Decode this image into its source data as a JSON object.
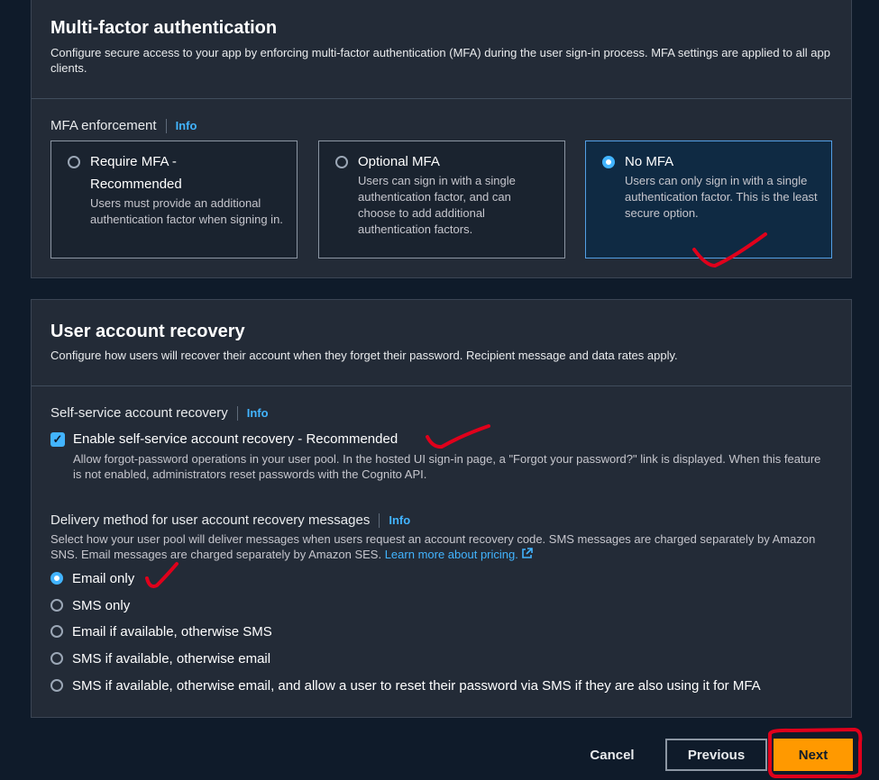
{
  "mfa": {
    "title": "Multi-factor authentication",
    "description": "Configure secure access to your app by enforcing multi-factor authentication (MFA) during the user sign-in process. MFA settings are applied to all app clients.",
    "enforcement_label": "MFA enforcement",
    "info": "Info",
    "options": [
      {
        "title": "Require MFA - Recommended",
        "desc": "Users must provide an additional authentication factor when signing in.",
        "selected": false
      },
      {
        "title": "Optional MFA",
        "desc": "Users can sign in with a single authentication factor, and can choose to add additional authentication factors.",
        "selected": false
      },
      {
        "title": "No MFA",
        "desc": "Users can only sign in with a single authentication factor. This is the least secure option.",
        "selected": true
      }
    ]
  },
  "recovery": {
    "title": "User account recovery",
    "description": "Configure how users will recover their account when they forget their password. Recipient message and data rates apply.",
    "self_service_label": "Self-service account recovery",
    "info": "Info",
    "enable_label": "Enable self-service account recovery - Recommended",
    "enable_checked": true,
    "enable_desc": "Allow forgot-password operations in your user pool. In the hosted UI sign-in page, a \"Forgot your password?\" link is displayed. When this feature is not enabled, administrators reset passwords with the Cognito API.",
    "delivery_label": "Delivery method for user account recovery messages",
    "delivery_info": "Info",
    "delivery_desc": "Select how your user pool will deliver messages when users request an account recovery code. SMS messages are charged separately by Amazon SNS. Email messages are charged separately by Amazon SES.",
    "pricing_link": "Learn more about pricing.",
    "delivery_options": [
      {
        "label": "Email only",
        "selected": true
      },
      {
        "label": "SMS only",
        "selected": false
      },
      {
        "label": "Email if available, otherwise SMS",
        "selected": false
      },
      {
        "label": "SMS if available, otherwise email",
        "selected": false
      },
      {
        "label": "SMS if available, otherwise email, and allow a user to reset their password via SMS if they are also using it for MFA",
        "selected": false
      }
    ]
  },
  "footer": {
    "cancel": "Cancel",
    "previous": "Previous",
    "next": "Next"
  },
  "colors": {
    "accent": "#42b4ff",
    "primary_button": "#ff9900",
    "annotation": "#e0001b"
  }
}
